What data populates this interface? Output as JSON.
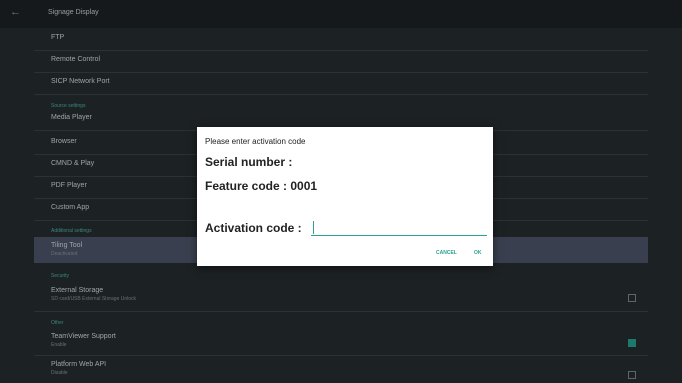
{
  "appbar": {
    "title": "Signage Display",
    "back_icon": "arrow-left-icon"
  },
  "rows": [
    {
      "label": "FTP"
    },
    {
      "label": "Remote Control"
    },
    {
      "label": "SICP Network Port"
    },
    {
      "label": "Media Player"
    },
    {
      "label": "Browser"
    },
    {
      "label": "CMND & Play"
    },
    {
      "label": "PDF Player"
    },
    {
      "label": "Custom App"
    },
    {
      "label": "Tiling Tool",
      "sub": "Deactivated"
    },
    {
      "label": "External Storage",
      "sub": "SD card/USB External Storage Unlock"
    },
    {
      "label": "TeamViewer Support",
      "sub": "Enable"
    },
    {
      "label": "Platform Web API",
      "sub": "Disable"
    }
  ],
  "headers": {
    "source": "Source settings",
    "additional": "Additional settings",
    "security": "Security",
    "other": "Other"
  },
  "dialog": {
    "title": "Please enter activation code",
    "serial": "Serial number :",
    "feature": "Feature code : 0001",
    "activation_label": "Activation code :",
    "activation_value": "",
    "cancel": "CANCEL",
    "ok": "OK"
  },
  "checkboxes": {
    "external_storage": false,
    "teamviewer_support": true,
    "platform_web_api": false
  },
  "colors": {
    "accent": "#27a38f",
    "background": "#262d30",
    "selected_row": "#4c5569"
  }
}
